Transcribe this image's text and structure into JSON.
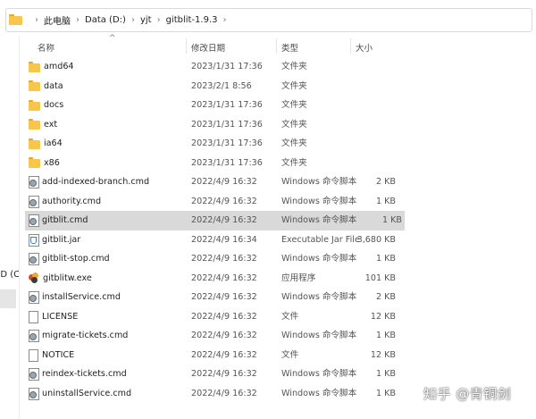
{
  "address_bar": {
    "crumbs": [
      "此电脑",
      "Data (D:)",
      "yjt",
      "gitblit-1.9.3"
    ]
  },
  "nav": {
    "partial_label": "SD (C"
  },
  "columns": {
    "name": "名称",
    "date": "修改日期",
    "type": "类型",
    "size": "大小"
  },
  "rows": [
    {
      "name": "amd64",
      "date": "2023/1/31 17:36",
      "type": "文件夹",
      "size": "",
      "icon": "folder-icon"
    },
    {
      "name": "data",
      "date": "2023/2/1 8:56",
      "type": "文件夹",
      "size": "",
      "icon": "folder-icon"
    },
    {
      "name": "docs",
      "date": "2023/1/31 17:36",
      "type": "文件夹",
      "size": "",
      "icon": "folder-icon"
    },
    {
      "name": "ext",
      "date": "2023/1/31 17:36",
      "type": "文件夹",
      "size": "",
      "icon": "folder-icon"
    },
    {
      "name": "ia64",
      "date": "2023/1/31 17:36",
      "type": "文件夹",
      "size": "",
      "icon": "folder-icon"
    },
    {
      "name": "x86",
      "date": "2023/1/31 17:36",
      "type": "文件夹",
      "size": "",
      "icon": "folder-icon"
    },
    {
      "name": "add-indexed-branch.cmd",
      "date": "2022/4/9 16:32",
      "type": "Windows 命令脚本",
      "size": "2 KB",
      "icon": "cmd-script-icon"
    },
    {
      "name": "authority.cmd",
      "date": "2022/4/9 16:32",
      "type": "Windows 命令脚本",
      "size": "1 KB",
      "icon": "cmd-script-icon"
    },
    {
      "name": "gitblit.cmd",
      "date": "2022/4/9 16:32",
      "type": "Windows 命令脚本",
      "size": "1 KB",
      "icon": "cmd-script-icon",
      "selected": true
    },
    {
      "name": "gitblit.jar",
      "date": "2022/4/9 16:34",
      "type": "Executable Jar File",
      "size": "3,680 KB",
      "icon": "jar-file-icon"
    },
    {
      "name": "gitblit-stop.cmd",
      "date": "2022/4/9 16:32",
      "type": "Windows 命令脚本",
      "size": "1 KB",
      "icon": "cmd-script-icon"
    },
    {
      "name": "gitblitw.exe",
      "date": "2022/4/9 16:32",
      "type": "应用程序",
      "size": "101 KB",
      "icon": "application-icon"
    },
    {
      "name": "installService.cmd",
      "date": "2022/4/9 16:32",
      "type": "Windows 命令脚本",
      "size": "2 KB",
      "icon": "cmd-script-icon"
    },
    {
      "name": "LICENSE",
      "date": "2022/4/9 16:32",
      "type": "文件",
      "size": "12 KB",
      "icon": "file-icon"
    },
    {
      "name": "migrate-tickets.cmd",
      "date": "2022/4/9 16:32",
      "type": "Windows 命令脚本",
      "size": "1 KB",
      "icon": "cmd-script-icon"
    },
    {
      "name": "NOTICE",
      "date": "2022/4/9 16:32",
      "type": "文件",
      "size": "12 KB",
      "icon": "file-icon"
    },
    {
      "name": "reindex-tickets.cmd",
      "date": "2022/4/9 16:32",
      "type": "Windows 命令脚本",
      "size": "1 KB",
      "icon": "cmd-script-icon"
    },
    {
      "name": "uninstallService.cmd",
      "date": "2022/4/9 16:32",
      "type": "Windows 命令脚本",
      "size": "1 KB",
      "icon": "cmd-script-icon"
    }
  ],
  "watermark": "知乎 @青铜剑",
  "colors": {
    "folder": "#f8c64a",
    "selected_row": "#d9d9d9"
  }
}
